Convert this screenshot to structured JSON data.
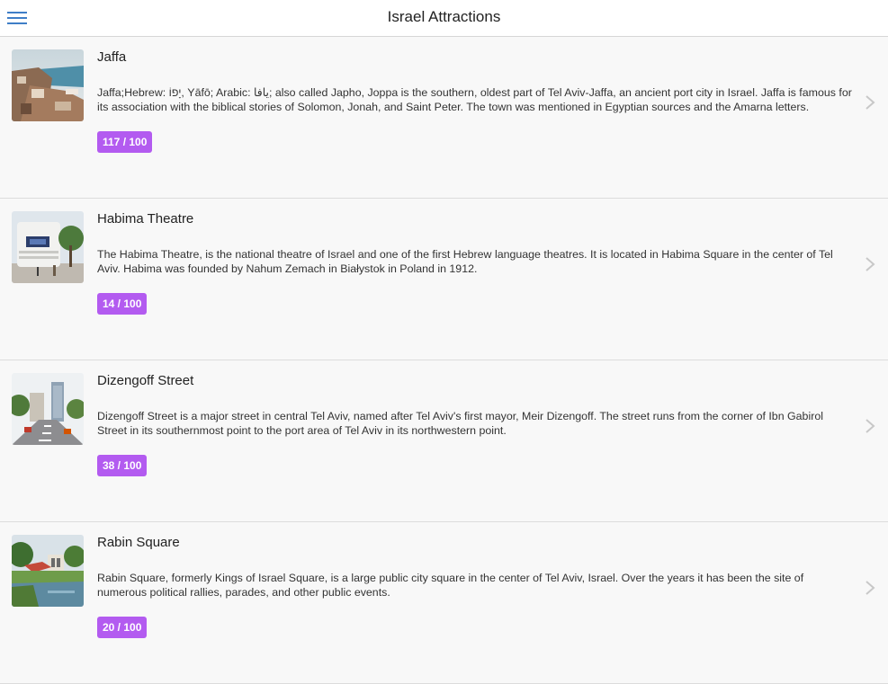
{
  "header": {
    "title": "Israel Attractions",
    "menu_icon": "hamburger-menu-icon"
  },
  "colors": {
    "accent": "#3f7ec7",
    "badge": "#b35bf0",
    "chevron": "#c8c8c8"
  },
  "items": [
    {
      "title": "Jaffa",
      "description": "Jaffa;Hebrew: יָפוֹ‎, Yāfō; Arabic: يافا‎; also called Japho, Joppa is the southern, oldest part of Tel Aviv-Jaffa, an ancient port city in Israel. Jaffa is famous for its association with the biblical stories of Solomon, Jonah, and Saint Peter. The town was mentioned in Egyptian sources and the Amarna letters.",
      "score": "117 / 100"
    },
    {
      "title": "Habima Theatre",
      "description": "The Habima Theatre, is the national theatre of Israel and one of the first Hebrew language theatres. It is located in Habima Square in the center of Tel Aviv. Habima was founded by Nahum Zemach in Białystok in Poland in 1912.",
      "score": "14 / 100"
    },
    {
      "title": "Dizengoff Street",
      "description": "Dizengoff Street is a major street in central Tel Aviv, named after Tel Aviv's first mayor, Meir Dizengoff. The street runs from the corner of Ibn Gabirol Street in its southernmost point to the port area of Tel Aviv in its northwestern point.",
      "score": "38 / 100"
    },
    {
      "title": "Rabin Square",
      "description": "Rabin Square, formerly Kings of Israel Square, is a large public city square in the center of Tel Aviv, Israel. Over the years it has been the site of numerous political rallies, parades, and other public events.",
      "score": "20 / 100"
    }
  ]
}
